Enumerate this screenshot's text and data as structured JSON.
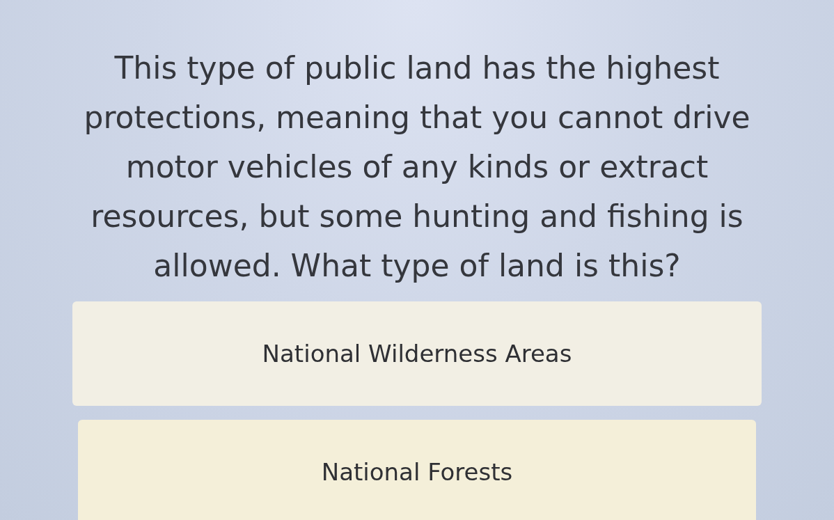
{
  "question": "This type of public land has the highest protections, meaning that you cannot drive motor vehicles of any kinds or extract resources, but some hunting and fishing is allowed. What type of land is this?",
  "answers": [
    {
      "label": "National Wilderness Areas"
    },
    {
      "label": "National Forests"
    }
  ]
}
